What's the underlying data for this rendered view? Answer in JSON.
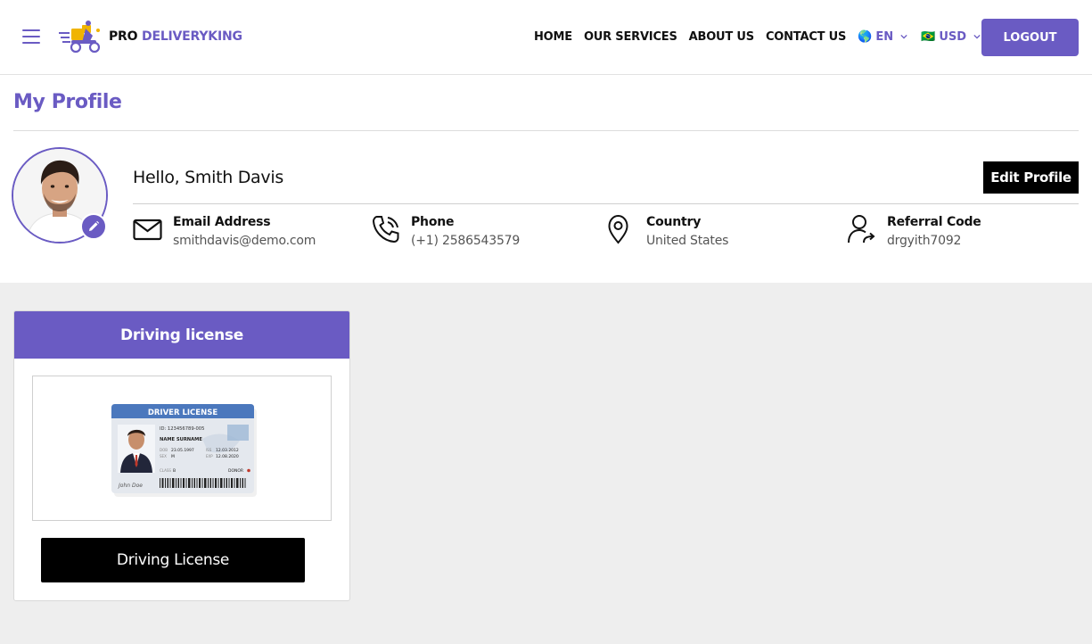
{
  "header": {
    "logo": {
      "part1": "PRO",
      "part2": "DELIVERYKING"
    },
    "nav": [
      {
        "label": "HOME"
      },
      {
        "label": "OUR SERVICES"
      },
      {
        "label": "ABOUT US"
      },
      {
        "label": "CONTACT US"
      }
    ],
    "language": {
      "flag": "🌎",
      "label": "EN"
    },
    "currency": {
      "flag": "🇧🇷",
      "label": "USD"
    },
    "logout_label": "LOGOUT"
  },
  "profile": {
    "title": "My Profile",
    "greeting": "Hello, Smith Davis",
    "edit_label": "Edit Profile",
    "fields": {
      "email": {
        "label": "Email Address",
        "value": "smithdavis@demo.com"
      },
      "phone": {
        "label": "Phone",
        "value": "(+1) 2586543579"
      },
      "country": {
        "label": "Country",
        "value": "United States"
      },
      "referral": {
        "label": "Referral Code",
        "value": "drgyith7092"
      }
    }
  },
  "license_card": {
    "title": "Driving license",
    "image": {
      "heading": "DRIVER LICENSE",
      "id_line": "ID: 123456789-005",
      "name_line": "NAME SURNAME",
      "dob_label": "DOB",
      "dob": "23.05.1997",
      "sex_label": "SEX",
      "sex": "M",
      "iss_label": "ISS",
      "iss": "12.03.2012",
      "exp_label": "EXP",
      "exp": "12.08.2020",
      "class_label": "CLASS",
      "class": "B",
      "donor": "DONOR",
      "signature": "John Doe"
    },
    "button_label": "Driving License"
  },
  "colors": {
    "accent": "#6a5bc3",
    "black": "#000000",
    "background": "#eeeeee"
  }
}
